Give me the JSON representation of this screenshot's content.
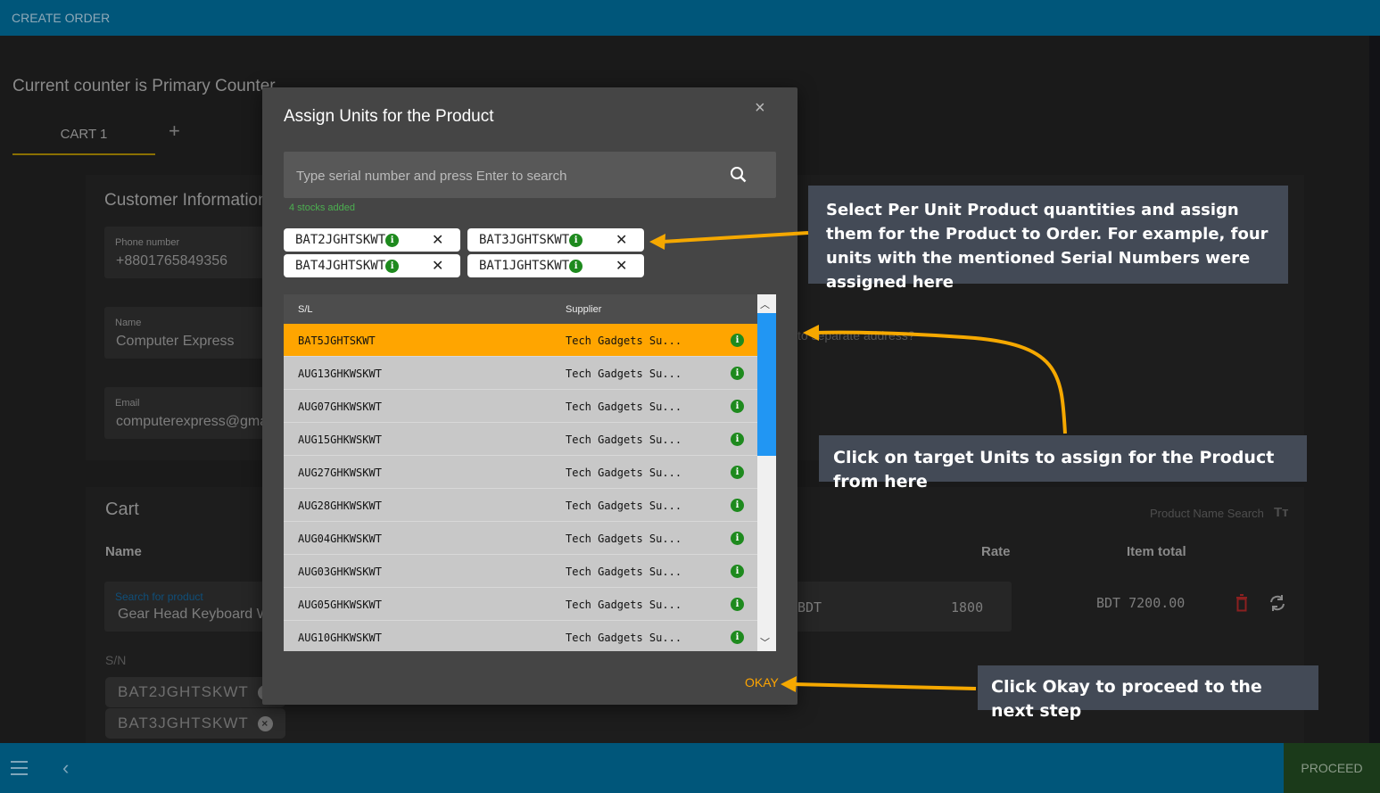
{
  "app": {
    "title": "CREATE ORDER",
    "counter": "Current counter is Primary Counter"
  },
  "tabs": [
    {
      "label": "CART 1"
    }
  ],
  "add_tab": "+",
  "customer": {
    "heading": "Customer Information",
    "phone_label": "Phone number",
    "phone": "+8801765849356",
    "name_label": "Name",
    "name": "Computer Express",
    "email_label": "Email",
    "email": "computerexpress@gmail.com",
    "separate_address": "to separate address?"
  },
  "cart": {
    "heading": "Cart",
    "col_name": "Name",
    "col_rate": "Rate",
    "col_item_total": "Item total",
    "product_search_label": "Search for product",
    "product": "Gear Head Keyboard Wired",
    "product_name_search": "Product Name Search",
    "sn_label": "S/N",
    "serials": [
      "BAT2JGHTSKWT",
      "BAT3JGHTSKWT"
    ],
    "rate_prefix": "BDT",
    "rate": "1800",
    "item_total": "BDT 7200.00"
  },
  "bottom": {
    "proceed": "PROCEED"
  },
  "modal": {
    "title": "Assign Units for the Product",
    "search_placeholder": "Type serial number and press Enter to search",
    "stocks_added": "4 stocks added",
    "chips": [
      "BAT2JGHTSKWT",
      "BAT3JGHTSKWT",
      "BAT4JGHTSKWT",
      "BAT1JGHTSKWT"
    ],
    "columns": [
      "S/L",
      "Supplier"
    ],
    "rows": [
      {
        "sl": "BAT5JGHTSKWT",
        "supplier": "Tech Gadgets Su...",
        "selected": true
      },
      {
        "sl": "AUG13GHKWSKWT",
        "supplier": "Tech Gadgets Su..."
      },
      {
        "sl": "AUG07GHKWSKWT",
        "supplier": "Tech Gadgets Su..."
      },
      {
        "sl": "AUG15GHKWSKWT",
        "supplier": "Tech Gadgets Su..."
      },
      {
        "sl": "AUG27GHKWSKWT",
        "supplier": "Tech Gadgets Su..."
      },
      {
        "sl": "AUG28GHKWSKWT",
        "supplier": "Tech Gadgets Su..."
      },
      {
        "sl": "AUG04GHKWSKWT",
        "supplier": "Tech Gadgets Su..."
      },
      {
        "sl": "AUG03GHKWSKWT",
        "supplier": "Tech Gadgets Su..."
      },
      {
        "sl": "AUG05GHKWSKWT",
        "supplier": "Tech Gadgets Su..."
      },
      {
        "sl": "AUG10GHKWSKWT",
        "supplier": "Tech Gadgets Su..."
      }
    ],
    "okay": "OKAY"
  },
  "callouts": {
    "chips": "Select Per Unit Product quantities and assign them for the Product to Order. For example, four units with the mentioned Serial Numbers were assigned here",
    "table": "Click on target Units to assign for the Product from here",
    "okay": "Click Okay to proceed to the next step"
  },
  "colors": {
    "topbar": "#00567a",
    "accent": "#ffa500",
    "info": "#1e8a1e",
    "proceed": "#1b3a1a"
  }
}
